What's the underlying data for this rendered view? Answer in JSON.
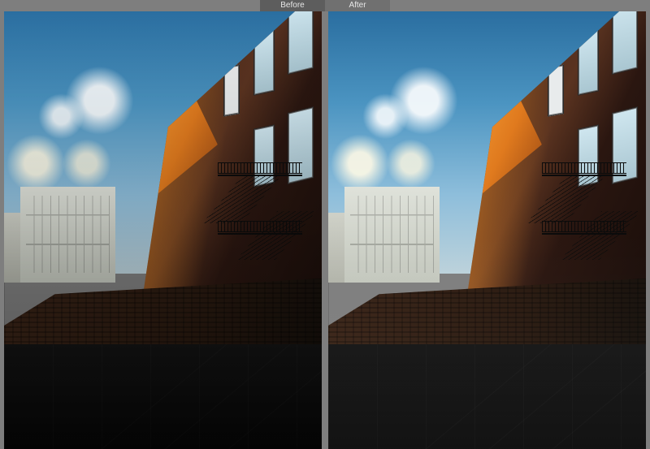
{
  "tabs": {
    "before": "Before",
    "after": "After"
  },
  "panels": {
    "left_alt": "before-photo",
    "right_alt": "after-photo"
  }
}
